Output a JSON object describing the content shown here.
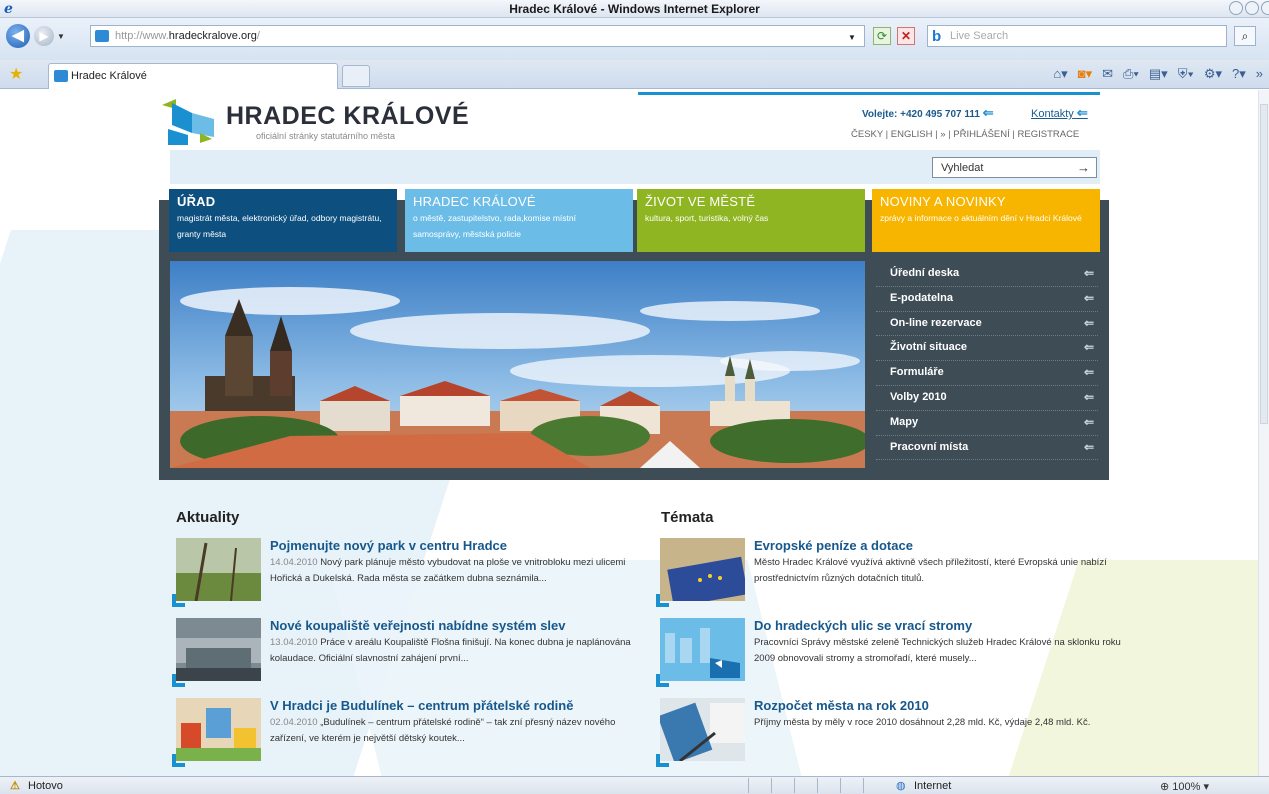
{
  "window": {
    "title": "Hradec Králové - Windows Internet Explorer",
    "address": {
      "prefix": "http://www.",
      "domain": "hradeckralove.org",
      "suffix": "/"
    },
    "search_placeholder": "Live Search",
    "tab_label": "Hradec Králové",
    "status_text": "Hotovo",
    "zone": "Internet",
    "zoom": "100%"
  },
  "header": {
    "logo_title": "HRADEC KRÁLOVÉ",
    "logo_subtitle": "oficiální stránky statutárního města",
    "phone": "Volejte: +420 495 707 111",
    "contacts": "Kontakty",
    "lang_line": "ČESKY | ENGLISH | » | PŘIHLÁŠENÍ | REGISTRACE",
    "search_placeholder": "Vyhledat"
  },
  "tiles": [
    {
      "title": "ÚŘAD",
      "desc": "magistrát města, elektronický úřad, odbory magistrátu, granty města",
      "color": "#0d4f7f"
    },
    {
      "title": "HRADEC KRÁLOVÉ",
      "desc": "o městě, zastupitelstvo, rada,komise místní samosprávy, městská policie",
      "color": "#6bbde8"
    },
    {
      "title": "ŽIVOT VE MĚSTĚ",
      "desc": "kultura, sport, turistika, volný čas",
      "color": "#8fb523"
    },
    {
      "title": "NOVINY A NOVINKY",
      "desc": "zprávy a informace o aktuálním dění v Hradci Králové",
      "color": "#f7b500"
    }
  ],
  "quicklinks": [
    "Úřední deska",
    "E-podatelna",
    "On-line rezervace",
    "Životní situace",
    "Formuláře",
    "Volby 2010",
    "Mapy",
    "Pracovní místa"
  ],
  "news": {
    "title": "Aktuality",
    "items": [
      {
        "title": "Pojmenujte nový park v centru Hradce",
        "date": "14.04.2010",
        "text": "Nový park plánuje město vybudovat na ploše ve vnitrobloku mezi ulicemi Hořická a Dukelská. Rada města se začátkem dubna seznámila..."
      },
      {
        "title": "Nové koupaliště veřejnosti nabídne systém slev",
        "date": "13.04.2010",
        "text": "Práce v areálu Koupaliště Flošna finišují. Na konec dubna je naplánována kolaudace. Oficiální slavnostní zahájení první..."
      },
      {
        "title": "V Hradci je Budulínek – centrum přátelské rodině",
        "date": "02.04.2010",
        "text": "„Budulínek – centrum přátelské rodině“ – tak zní přesný název nového zařízení, ve kterém je největší dětský koutek..."
      }
    ]
  },
  "topics": {
    "title": "Témata",
    "items": [
      {
        "title": "Evropské peníze a dotace",
        "text": "Město Hradec Králové využívá aktivně všech příležitostí, které Evropská unie nabízí prostřednictvím různých dotačních titulů."
      },
      {
        "title": "Do hradeckých ulic se vrací stromy",
        "text": "Pracovníci Správy městské zeleně Technických služeb Hradec Králové na sklonku roku 2009 obnovovali stromy a stromořadí, které musely..."
      },
      {
        "title": "Rozpočet města na rok 2010",
        "text": "Příjmy města by měly v roce 2010 dosáhnout 2,28 mld. Kč, výdaje 2,48 mld. Kč."
      }
    ]
  }
}
